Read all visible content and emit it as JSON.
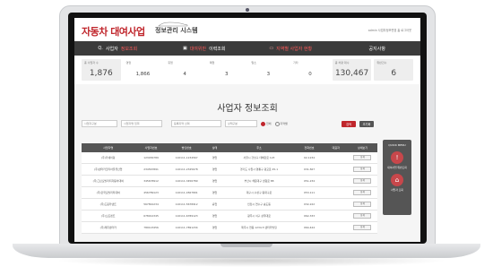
{
  "header": {
    "title": "자동차 대여사업",
    "subtitle": "정보관리 시스템",
    "utility_text": "admin  사업자정보변경  홈  로그아웃"
  },
  "nav": [
    {
      "pre": "Q.",
      "label": "사업자 ",
      "highlight": "정보조회"
    },
    {
      "pre": "▣",
      "label": "",
      "highlight": "대여위반",
      "post": " 이력조회"
    },
    {
      "pre": "▭",
      "label": "",
      "highlight": "지역별 사업자 현황"
    },
    {
      "pre": "",
      "label": "공지사항",
      "highlight": ""
    }
  ],
  "stats": [
    {
      "label": "총 사업자 수",
      "value": "1,876",
      "style": "big"
    },
    {
      "label": "영업",
      "value": "1,866",
      "style": "plain"
    },
    {
      "label": "휴업",
      "value": "4",
      "style": "plain"
    },
    {
      "label": "폐업",
      "value": "3",
      "style": "plain"
    },
    {
      "label": "말소",
      "value": "3",
      "style": "plain"
    },
    {
      "label": "기타",
      "value": "0",
      "style": "plain"
    },
    {
      "label": "총 차량 대수",
      "value": "130,467",
      "style": "big"
    },
    {
      "label": "위반건수",
      "value": "6",
      "style": "big"
    }
  ],
  "section_title": "사업자 정보조회",
  "filter": {
    "select1": "사업자구분",
    "select2": "사업자명 입력",
    "select3": "등록지역 선택",
    "select4": "상태구분",
    "radio1": "전체",
    "radio2": "지역별",
    "search_btn": "검색",
    "reset_btn": "초기화"
  },
  "table": {
    "headers": [
      "사업자명",
      "사업자번호",
      "법인번호",
      "상태",
      "주소",
      "전화번호",
      "대표자",
      "상세보기"
    ],
    "rows": [
      [
        "(주)카셰어링",
        "123456789",
        "110111-1234567",
        "영업",
        "서울시 강남구 테헤란로 123",
        "02-1234",
        "",
        "상세"
      ],
      [
        "(주)렌터카코리아물류산업",
        "234567891",
        "110111-2345678",
        "영업",
        "경기도 수원시 영통구 광교로 45-1",
        "031-567",
        "",
        "상세"
      ],
      [
        "(주)그린모빌리티자동차대여",
        "345678912",
        "110111-3456789",
        "영업",
        "부산시 해운대구 센텀로 88",
        "051-234",
        "",
        "상세"
      ],
      [
        "(주)한국모빌리티대여",
        "456789123",
        "110111-4567891",
        "영업",
        "대구시 수성구 동대구로",
        "053-111",
        "",
        "상세"
      ],
      [
        "(주)드림카렌트",
        "567891234",
        "110111-5678912",
        "휴업",
        "인천시 연수구 송도동",
        "032-222",
        "",
        "상세"
      ],
      [
        "(주)오토렌트",
        "678912345",
        "110111-6789123",
        "영업",
        "광주시 서구 상무대로",
        "062-333",
        "",
        "상세"
      ],
      [
        "(주)제주렌터카",
        "789123456",
        "110111-7891234",
        "영업",
        "제주시 연동 1234-5 렌터카빌딩",
        "064-444",
        "",
        "상세"
      ]
    ]
  },
  "side_panel": {
    "title": "QUICK MENU",
    "item1": "대여사업 위반조회",
    "item2": "사업자 조회"
  }
}
